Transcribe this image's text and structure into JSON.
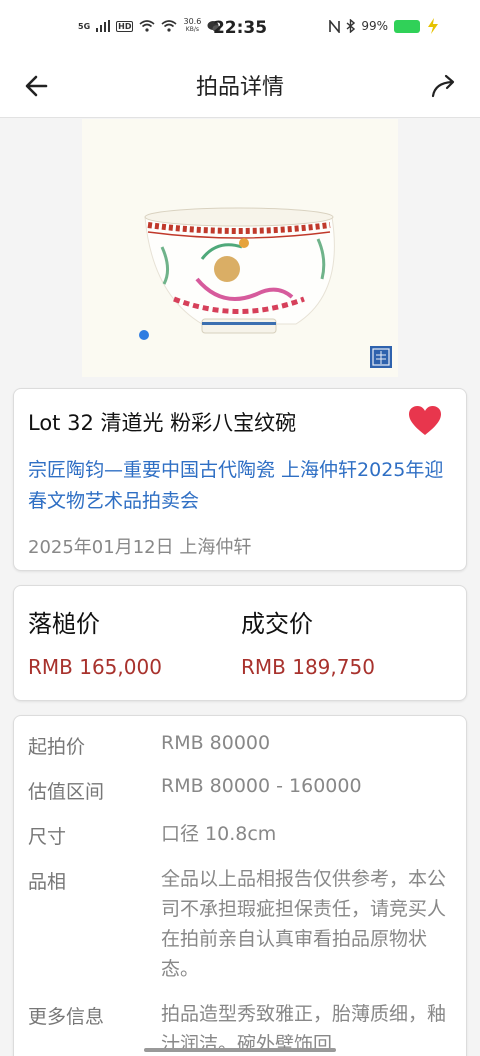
{
  "status_bar": {
    "network": "5G",
    "hd": "HD",
    "speed": "30.6",
    "speed_unit": "KB/s",
    "time": "22:35",
    "battery": "99%"
  },
  "nav": {
    "title": "拍品详情"
  },
  "lot": {
    "title": "Lot 32 清道光 粉彩八宝纹碗",
    "auction": "宗匠陶钧—重要中国古代陶瓷 上海仲轩2025年迎春文物艺术品拍卖会",
    "date_place": "2025年01月12日 上海仲轩"
  },
  "prices": {
    "hammer_label": "落槌价",
    "hammer_value": "RMB 165,000",
    "deal_label": "成交价",
    "deal_value": "RMB 189,750"
  },
  "details": [
    {
      "key": "起拍价",
      "value": "RMB 80000"
    },
    {
      "key": "估值区间",
      "value": "RMB 80000 - 160000"
    },
    {
      "key": "尺寸",
      "value": "口径 10.8cm"
    },
    {
      "key": "品相",
      "value": "全品以上品相报告仅供参考，本公司不承担瑕疵担保责任，请竞买人在拍前亲自认真审看拍品原物状态。"
    },
    {
      "key": "更多信息",
      "value": "拍品造型秀致雅正，胎薄质细，釉汁润洁。碗外壁饰回"
    }
  ],
  "colors": {
    "link": "#2f6fc4",
    "price": "#a8322d",
    "heart": "#e8364d",
    "dot": "#2f7de1"
  }
}
